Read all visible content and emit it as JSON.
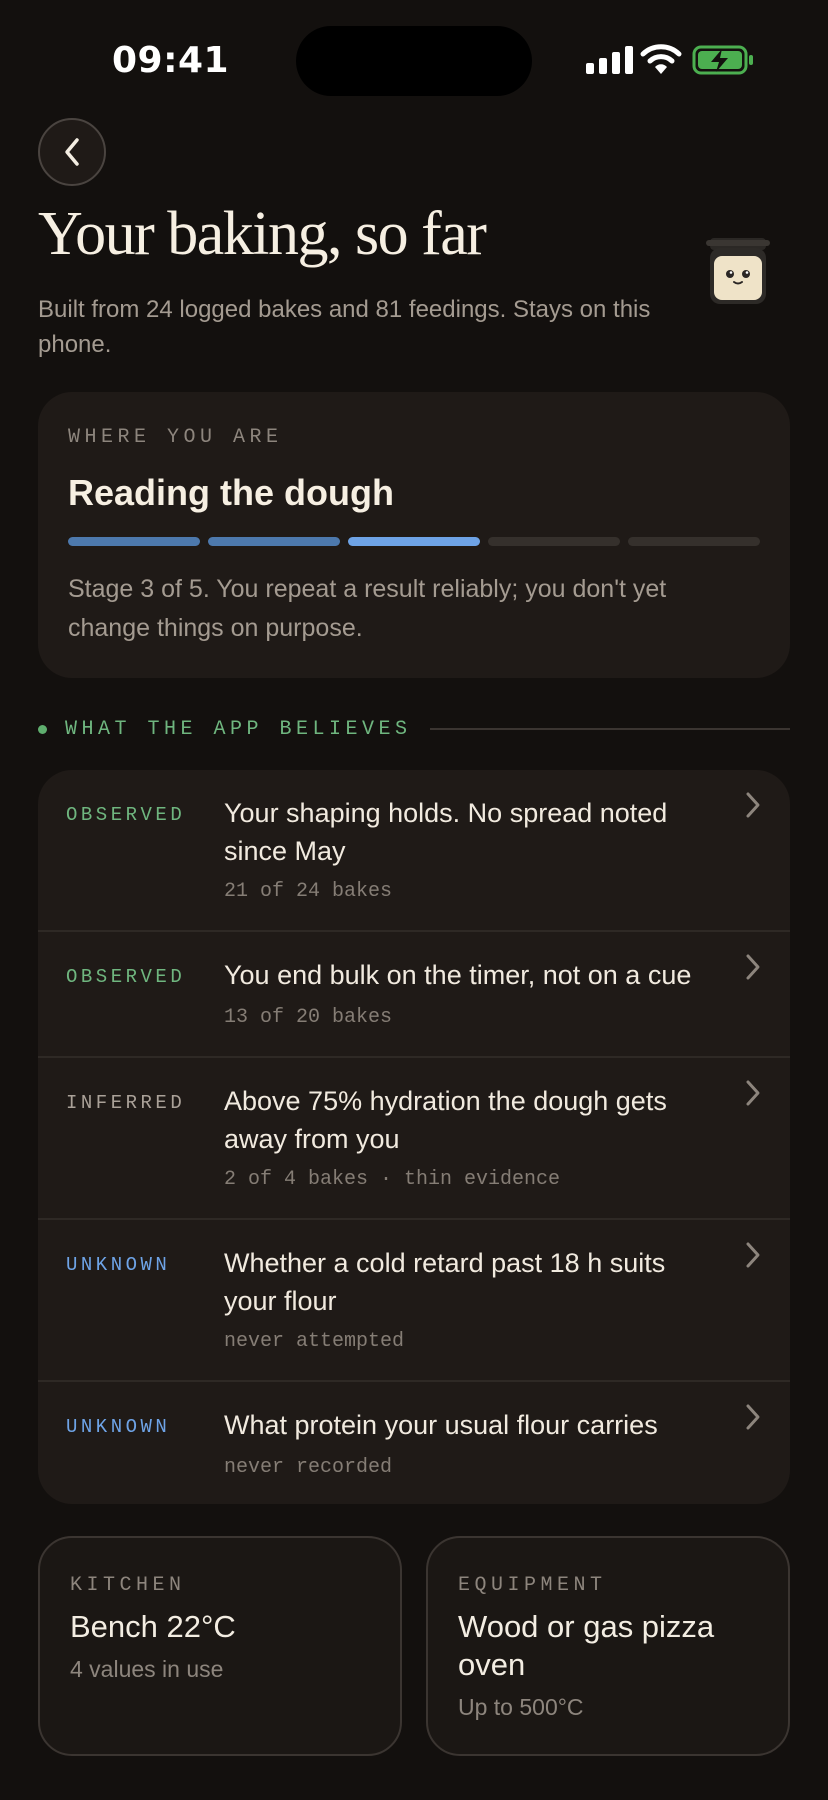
{
  "status_bar": {
    "time": "09:41"
  },
  "header": {
    "title": "Your baking, so far",
    "subtitle": "Built from 24 logged bakes and 81 feedings. Stays on this phone."
  },
  "stage": {
    "eyebrow": "WHERE YOU ARE",
    "name": "Reading the dough",
    "current": 3,
    "total": 5,
    "description": "Stage 3 of 5. You repeat a result reliably; you don't yet change things on purpose."
  },
  "beliefs": {
    "section_label": "WHAT THE APP BELIEVES",
    "items": [
      {
        "tag": "OBSERVED",
        "claim": "Your shaping holds. No spread noted since May",
        "evidence": "21 of 24 bakes"
      },
      {
        "tag": "OBSERVED",
        "claim": "You end bulk on the timer, not on a cue",
        "evidence": "13 of 20 bakes"
      },
      {
        "tag": "INFERRED",
        "claim": "Above 75% hydration the dough gets away from you",
        "evidence": "2 of 4 bakes · thin evidence"
      },
      {
        "tag": "UNKNOWN",
        "claim": "Whether a cold retard past 18 h suits your flour",
        "evidence": "never attempted"
      },
      {
        "tag": "UNKNOWN",
        "claim": "What protein your usual flour carries",
        "evidence": "never recorded"
      }
    ]
  },
  "cards": {
    "kitchen": {
      "eyebrow": "KITCHEN",
      "value": "Bench 22°C",
      "note": "4 values in use"
    },
    "equipment": {
      "eyebrow": "EQUIPMENT",
      "value": "Wood or gas pizza oven",
      "note": "Up to 500°C"
    }
  },
  "colors": {
    "background": "#13100e",
    "card": "#1f1a17",
    "observed": "#6fb67f",
    "unknown": "#6ea3e6",
    "inferred": "#aaa198",
    "battery": "#4caf50"
  },
  "icons": {
    "back": "chevron-left-icon",
    "row_chevron": "chevron-right-icon",
    "mascot": "starter-jar-icon"
  }
}
